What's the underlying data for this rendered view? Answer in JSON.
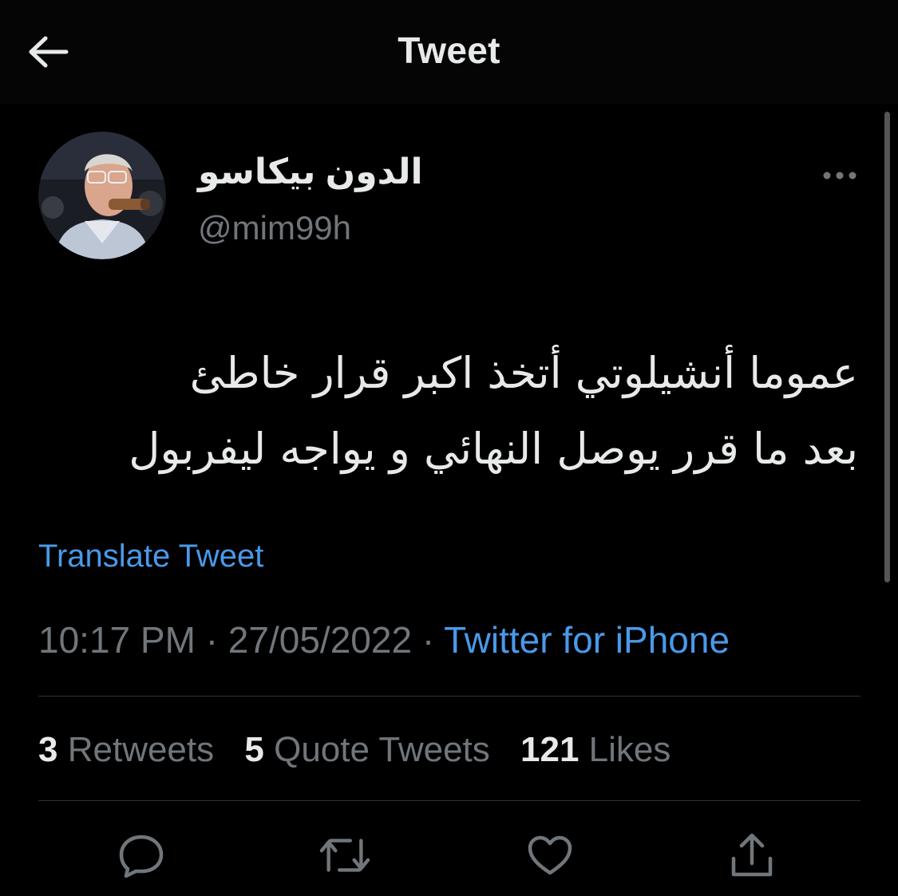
{
  "header": {
    "title": "Tweet",
    "back_icon": "arrow-left-icon"
  },
  "author": {
    "display_name": "الدون بيكاسو",
    "handle": "@mim99h",
    "more_icon": "more-horizontal-icon"
  },
  "tweet": {
    "lines": [
      "عموما أنشيلوتي أتخذ اكبر قرار خاطئ",
      "بعد ما قرر يوصل النهائي و يواجه ليفربول"
    ],
    "translate_label": "Translate Tweet",
    "time": "10:17 PM",
    "separator": "·",
    "date": "27/05/2022",
    "source": "Twitter for iPhone"
  },
  "stats": {
    "retweets_count": "3",
    "retweets_label": "Retweets",
    "quotes_count": "5",
    "quotes_label": "Quote Tweets",
    "likes_count": "121",
    "likes_label": "Likes"
  },
  "actions": [
    "reply-icon",
    "retweet-icon",
    "like-icon",
    "share-icon"
  ],
  "colors": {
    "background": "#000000",
    "text": "#e7e9ea",
    "muted": "#71767b",
    "link": "#4a99e9",
    "divider": "#2f3336"
  }
}
